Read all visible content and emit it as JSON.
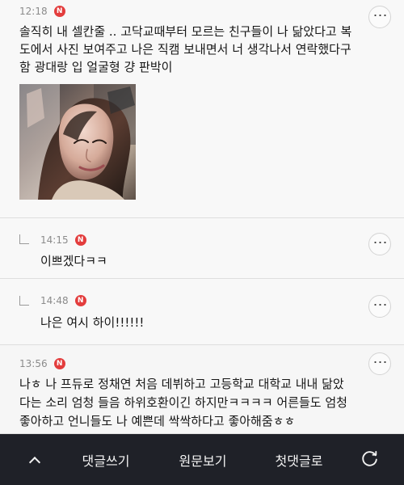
{
  "comments": [
    {
      "time": "12:18",
      "badge": "N",
      "text": "솔직히 내 셀칸줄 .. 고닥교때부터 모르는 친구들이 나 닮았다고 복\n도에서 사진 보여주고 나은 직캠 보내면서 너 생각나서 연락했다구\n함 광대랑 입 얼굴형 걍 판박이",
      "more_label": "⋯",
      "has_photo": true
    },
    {
      "time": "14:15",
      "badge": "N",
      "text": "이쁘겠다ㅋㅋ",
      "more_label": "⋯",
      "is_reply": true
    },
    {
      "time": "14:48",
      "badge": "N",
      "text": "나은 여시 하이!!!!!!",
      "more_label": "⋯",
      "is_reply": true
    },
    {
      "time": "13:56",
      "badge": "N",
      "text": "나ㅎ 나 프듀로 정채연 처음 데뷔하고 고등학교 대학교 내내 닮았\n다는 소리 엄청 들음 하위호환이긴 하지만ㅋㅋㅋㅋ 어른들도 엄청\n좋아하고 언니들도 나 예쁜데 싹싹하다고 좋아해줌ㅎㅎ",
      "more_label": "⋯"
    }
  ],
  "bottom_bar": {
    "up_icon": "chevron-up-icon",
    "comment_label": "댓글쓰기",
    "original_label": "원문보기",
    "first_label": "첫댓글로",
    "refresh_icon": "refresh-icon"
  },
  "colors": {
    "badge": "#e33d3d",
    "bottom_bar": "#1f2128",
    "background": "#f8f8f8"
  }
}
